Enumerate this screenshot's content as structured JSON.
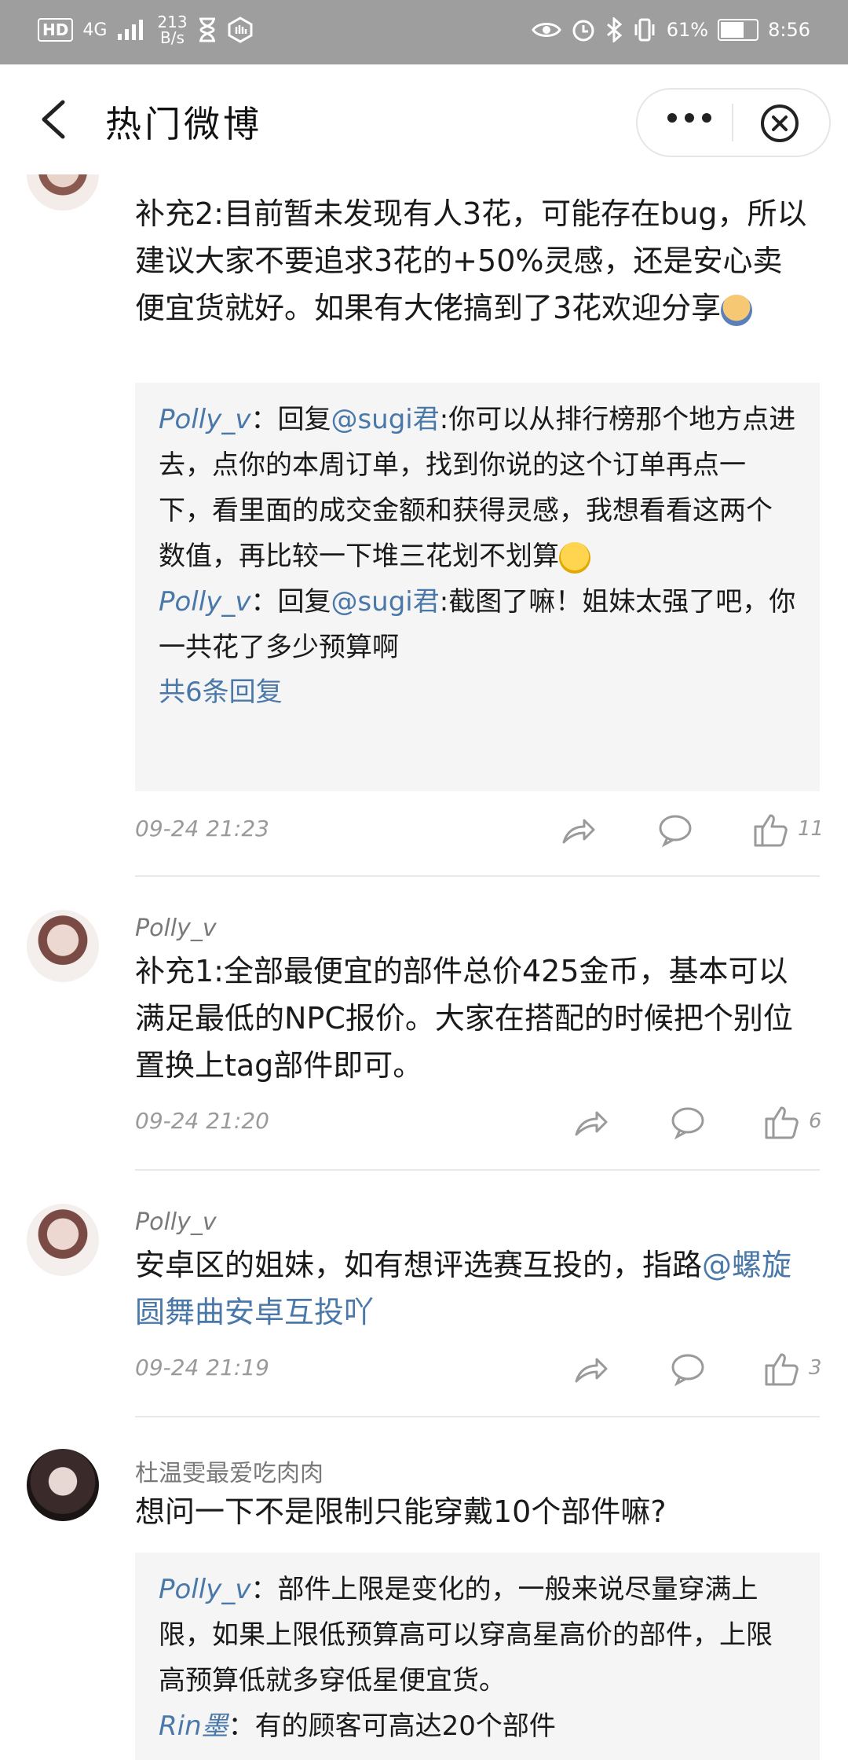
{
  "status_bar": {
    "hd": "HD",
    "network": "4G",
    "speed_value": "213",
    "speed_unit": "B/s",
    "battery_percent": "61%",
    "time": "8:56"
  },
  "nav": {
    "title": "热门微博"
  },
  "comments": [
    {
      "text": "补充2:目前暂未发现有人3花，可能存在bug，所以建议大家不要追求3花的+50%灵感，还是安心卖便宜货就好。如果有大佬搞到了3花欢迎分享",
      "replies": [
        {
          "user": "Polly_v",
          "sep": "：",
          "prefix": "回复",
          "at": "@sugi君",
          "text": ":你可以从排行榜那个地方点进去，点你的本周订单，找到你说的这个订单再点一下，看里面的成交金额和获得灵感，我想看看这两个数值，再比较一下堆三花划不划算"
        },
        {
          "user": "Polly_v",
          "sep": "：",
          "prefix": "回复",
          "at": "@sugi君",
          "text": ":截图了嘛！姐妹太强了吧，你一共花了多少预算啊"
        }
      ],
      "more": "共6条回复",
      "time": "09-24 21:23",
      "likes": "11"
    },
    {
      "user": "Polly_v",
      "text": "补充1:全部最便宜的部件总价425金币，基本可以满足最低的NPC报价。大家在搭配的时候把个别位置换上tag部件即可。",
      "time": "09-24 21:20",
      "likes": "6"
    },
    {
      "user": "Polly_v",
      "text": "安卓区的姐妹，如有想评选赛互投的，指路",
      "link": "@螺旋圆舞曲安卓互投吖",
      "time": "09-24 21:19",
      "likes": "3"
    },
    {
      "user": "杜温雯最爱吃肉肉",
      "text": "想问一下不是限制只能穿戴10个部件嘛?",
      "replies": [
        {
          "user": "Polly_v",
          "sep": "：",
          "text": "部件上限是变化的，一般来说尽量穿满上限，如果上限低预算高可以穿高星高价的部件，上限高预算低就多穿低星便宜货。"
        },
        {
          "user": "Rin墨",
          "sep": "：",
          "text": "有的顾客可高达20个部件"
        }
      ]
    }
  ],
  "colors": {
    "status_bar": "#9e9e9e",
    "link": "#4a78a8",
    "reply_bg": "#f5f5f5",
    "meta": "#9a9a9a"
  }
}
